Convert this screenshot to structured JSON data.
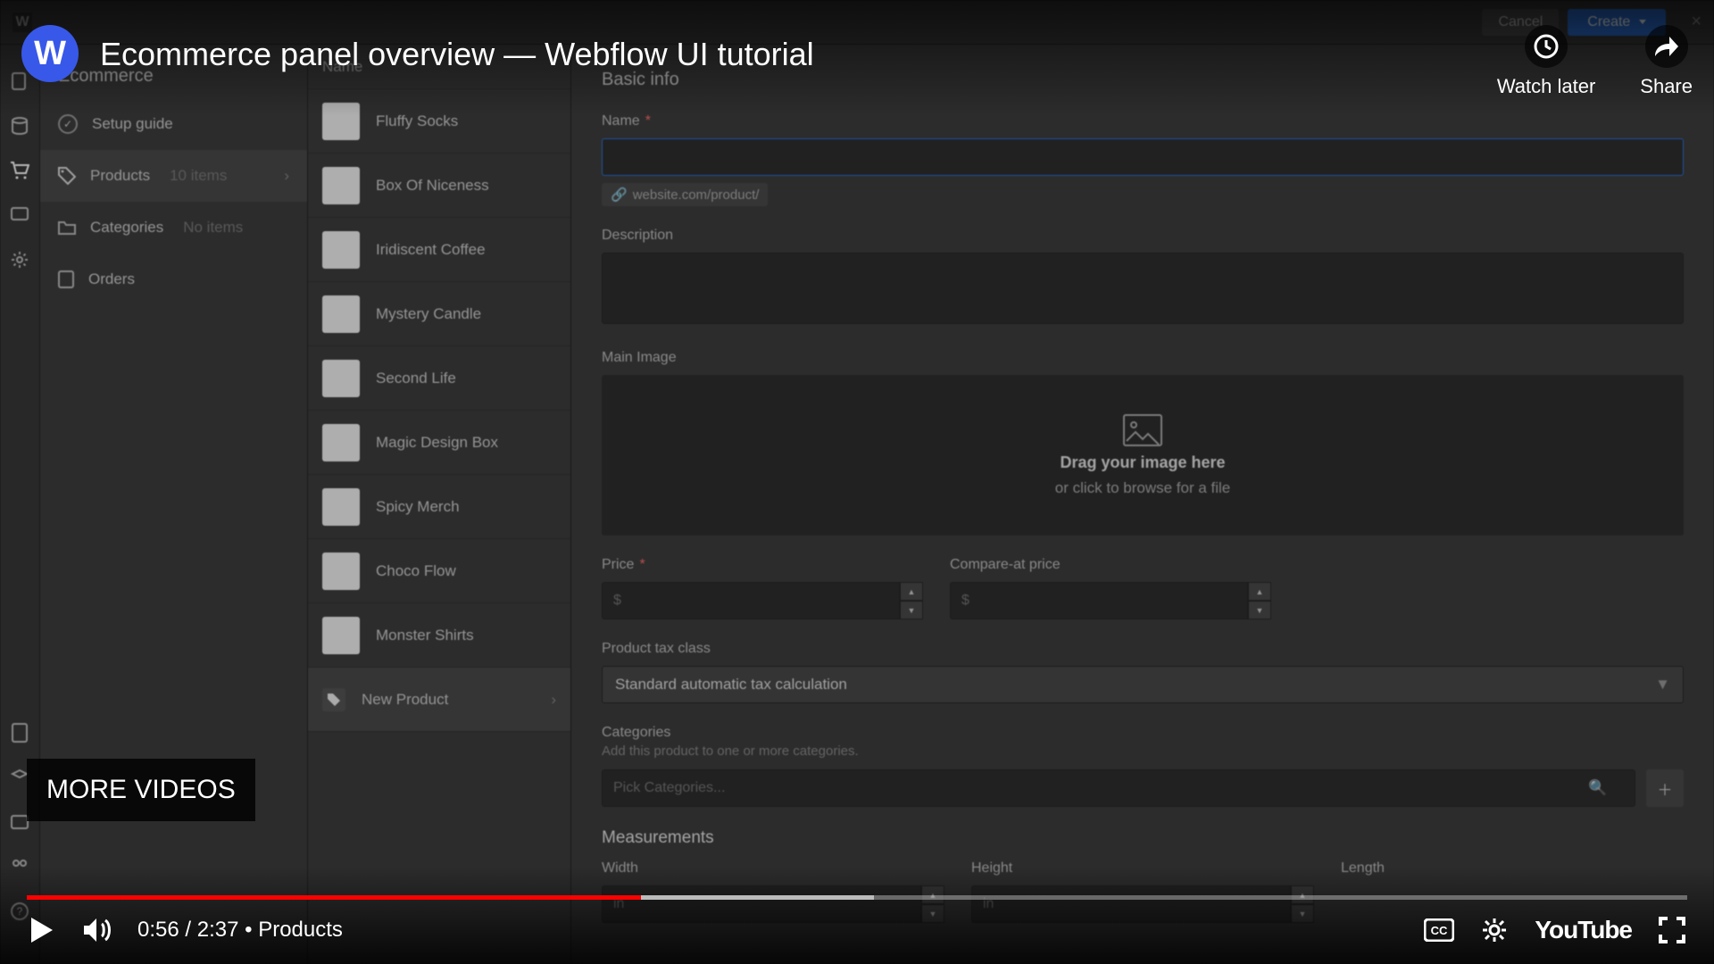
{
  "youtube": {
    "title": "Ecommerce panel overview — Webflow UI tutorial",
    "watch_later": "Watch later",
    "share": "Share",
    "more_videos": "MORE VIDEOS",
    "time_current": "0:56",
    "time_total": "2:37",
    "chapter": "Products",
    "progress_pct": 37,
    "brand": "YouTube",
    "avatar_letter": "W"
  },
  "wf": {
    "top": {
      "cancel": "Cancel",
      "create": "Create",
      "breadcrumb": "New Product"
    },
    "side_header": "Ecommerce",
    "side": [
      {
        "label": "Setup guide"
      },
      {
        "label": "Products",
        "count": "10 items",
        "active": true
      },
      {
        "label": "Categories",
        "count": "No items"
      },
      {
        "label": "Orders"
      }
    ],
    "list_header": "Name",
    "products": [
      {
        "name": "Fluffy Socks"
      },
      {
        "name": "Box Of Niceness"
      },
      {
        "name": "Iridiscent Coffee"
      },
      {
        "name": "Mystery Candle"
      },
      {
        "name": "Second Life"
      },
      {
        "name": "Magic Design Box"
      },
      {
        "name": "Spicy Merch"
      },
      {
        "name": "Choco Flow"
      },
      {
        "name": "Monster Shirts"
      },
      {
        "name": "New Product",
        "selected": true,
        "is_new": true
      }
    ],
    "form": {
      "section": "Basic info",
      "name_label": "Name",
      "name_value": "",
      "slug_prefix": "website.com/product/",
      "desc_label": "Description",
      "img_label": "Main Image",
      "drop_t1": "Drag your image here",
      "drop_t2": "or click to browse for a file",
      "price_label": "Price",
      "price_ph": "$",
      "compare_label": "Compare-at price",
      "compare_ph": "$",
      "tax_label": "Product tax class",
      "tax_value": "Standard automatic tax calculation",
      "cat_label": "Categories",
      "cat_sub": "Add this product to one or more categories.",
      "cat_ph": "Pick Categories...",
      "meas_label": "Measurements",
      "meas_w": "Width",
      "meas_h": "Height",
      "meas_l": "Length",
      "meas_unit": "in"
    }
  }
}
